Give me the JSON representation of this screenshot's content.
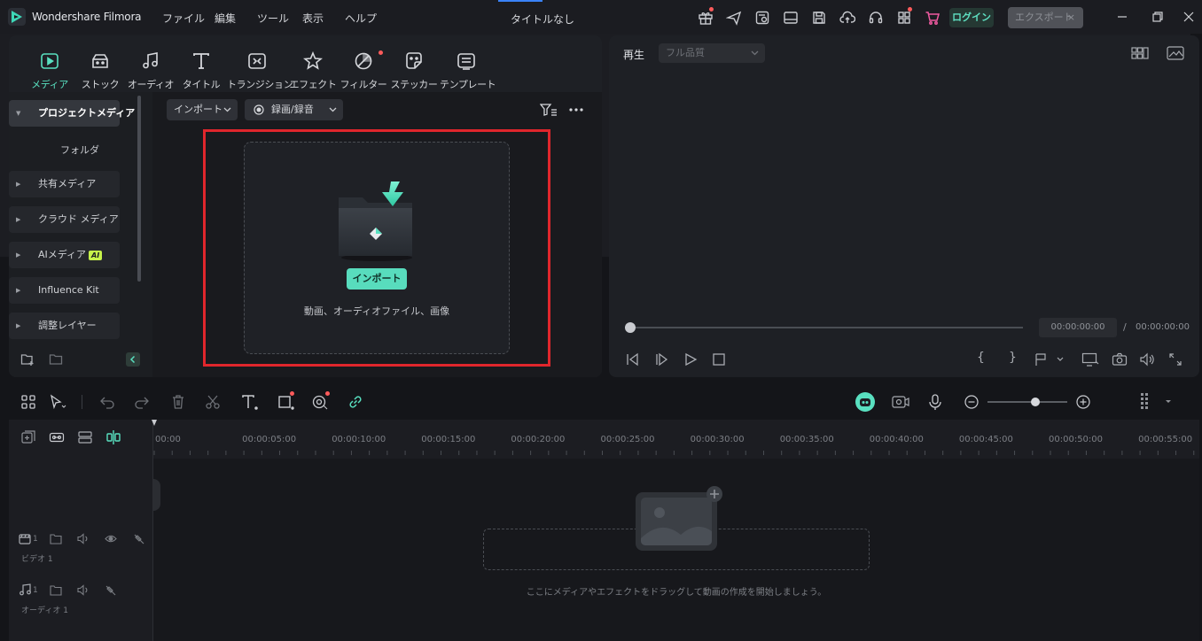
{
  "app": {
    "name": "Wondershare Filmora",
    "document_title": "タイトルなし",
    "menu": [
      "ファイル",
      "編集",
      "ツール",
      "表示",
      "ヘルプ"
    ],
    "login_label": "ログイン",
    "export_label": "エクスポート",
    "accent_color": "#59e0c0"
  },
  "media_tabs": [
    {
      "label": "メディア",
      "icon": "media-icon",
      "active": true
    },
    {
      "label": "ストック",
      "icon": "stock-icon"
    },
    {
      "label": "オーディオ",
      "icon": "music-note-icon"
    },
    {
      "label": "タイトル",
      "icon": "title-t-icon"
    },
    {
      "label": "トランジション",
      "icon": "transition-icon"
    },
    {
      "label": "エフェクト",
      "icon": "effect-star-icon"
    },
    {
      "label": "フィルター",
      "icon": "filter-icon"
    },
    {
      "label": "ステッカー",
      "icon": "sticker-icon"
    },
    {
      "label": "テンプレート",
      "icon": "template-icon"
    }
  ],
  "sidebar": {
    "items": [
      {
        "label": "プロジェクトメディア",
        "active": true
      },
      {
        "label": "フォルダ",
        "child": true
      },
      {
        "label": "共有メディア"
      },
      {
        "label": "クラウド メディア"
      },
      {
        "label": "AIメディア",
        "badge": "AI"
      },
      {
        "label": "Influence Kit"
      },
      {
        "label": "調整レイヤー"
      }
    ]
  },
  "media_toolbar": {
    "import_dropdown": "インポート",
    "record_dropdown": "録画/録音"
  },
  "drop_zone": {
    "import_button": "インポート",
    "hint": "動画、オーディオファイル、画像"
  },
  "preview": {
    "tab_label": "再生",
    "quality_select": "フル品質",
    "current_time": "00:00:00:00",
    "separator": "/",
    "total_time": "00:00:00:00",
    "progress": 0
  },
  "timeline": {
    "ruler": [
      "00:00",
      "00:00:05:00",
      "00:00:10:00",
      "00:00:15:00",
      "00:00:20:00",
      "00:00:25:00",
      "00:00:30:00",
      "00:00:35:00",
      "00:00:40:00",
      "00:00:45:00",
      "00:00:50:00",
      "00:00:55:00"
    ],
    "video_track_label": "ビデオ 1",
    "audio_track_label": "オーディオ 1",
    "video_track_num": "1",
    "audio_track_num": "1",
    "drop_hint": "ここにメディアやエフェクトをドラッグして動画の作成を開始しましょう。",
    "zoom_level": 0.6
  }
}
